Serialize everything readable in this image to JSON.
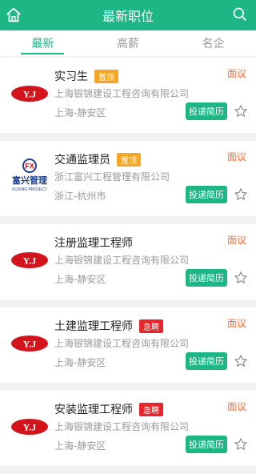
{
  "header": {
    "title": "最新职位"
  },
  "tabs": [
    {
      "label": "最新"
    },
    {
      "label": "高薪"
    },
    {
      "label": "名企"
    }
  ],
  "jobs": [
    {
      "title": "实习生",
      "badge": "置顶",
      "badge_type": "top",
      "company": "上海银锦建设工程咨询有限公司",
      "location": "上海-静安区",
      "salary": "面议",
      "apply": "投递简历",
      "logo": "yj"
    },
    {
      "title": "交通监理员",
      "badge": "置顶",
      "badge_type": "top",
      "company": "浙江富兴工程管理有限公司",
      "location": "浙江-杭州市",
      "salary": "面议",
      "apply": "投递简历",
      "logo": "fx"
    },
    {
      "title": "注册监理工程师",
      "badge": "",
      "badge_type": "",
      "company": "上海银锦建设工程咨询有限公司",
      "location": "上海-静安区",
      "salary": "面议",
      "apply": "投递简历",
      "logo": "yj"
    },
    {
      "title": "土建监理工程师",
      "badge": "急聘",
      "badge_type": "urgent",
      "company": "上海银锦建设工程咨询有限公司",
      "location": "上海-静安区",
      "salary": "面议",
      "apply": "投递简历",
      "logo": "yj"
    },
    {
      "title": "安装监理工程师",
      "badge": "急聘",
      "badge_type": "urgent",
      "company": "上海银锦建设工程咨询有限公司",
      "location": "上海-静安区",
      "salary": "面议",
      "apply": "投递简历",
      "logo": "yj"
    }
  ],
  "fx_logo": {
    "text": "富兴管理",
    "sub": "FUXING PROJECT",
    "mark": "FX"
  },
  "yj_logo": {
    "text": "Y.J"
  },
  "colors": {
    "primary": "#1cb784",
    "salary": "#f36f3b",
    "top_badge": "#f5a623",
    "urgent_badge": "#e8252a"
  }
}
